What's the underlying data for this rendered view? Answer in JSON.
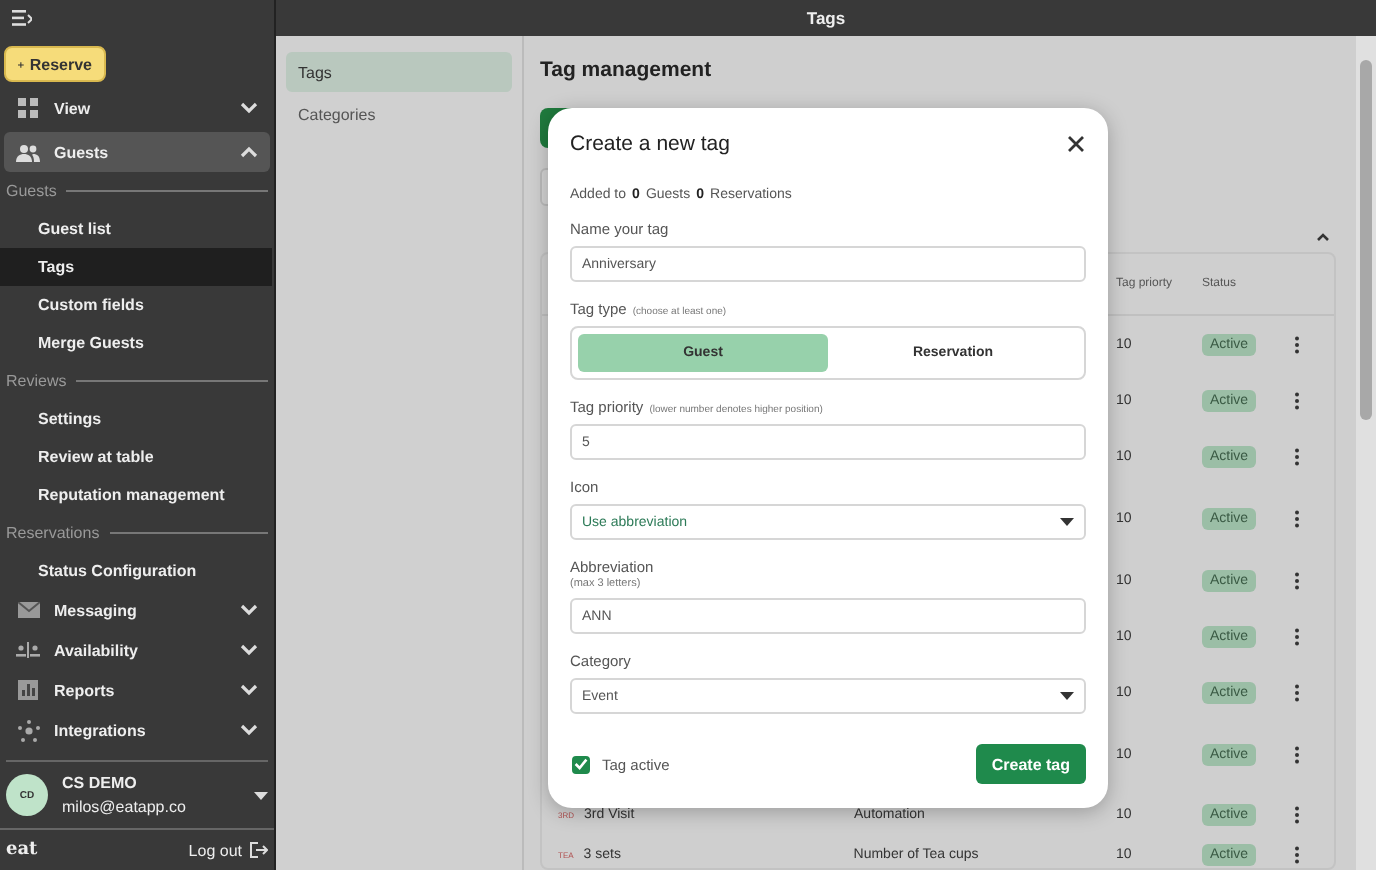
{
  "sidebar": {
    "reserve_button": "Reserve",
    "items": [
      {
        "kind": "group",
        "label": "View",
        "expanded": false,
        "selected": false
      },
      {
        "kind": "group",
        "label": "Guests",
        "expanded": true,
        "selected": true
      },
      {
        "kind": "section",
        "label": "Guests"
      },
      {
        "kind": "link",
        "label": "Guest list",
        "selected": false
      },
      {
        "kind": "link",
        "label": "Tags",
        "selected": true
      },
      {
        "kind": "link",
        "label": "Custom fields",
        "selected": false
      },
      {
        "kind": "link",
        "label": "Merge Guests",
        "selected": false
      },
      {
        "kind": "section",
        "label": "Reviews"
      },
      {
        "kind": "link",
        "label": "Settings",
        "selected": false
      },
      {
        "kind": "link",
        "label": "Review at table",
        "selected": false
      },
      {
        "kind": "link",
        "label": "Reputation management",
        "selected": false
      },
      {
        "kind": "section",
        "label": "Reservations"
      },
      {
        "kind": "link",
        "label": "Status Configuration",
        "selected": false
      },
      {
        "kind": "group",
        "label": "Messaging",
        "expanded": false,
        "selected": false
      },
      {
        "kind": "group",
        "label": "Availability",
        "expanded": false,
        "selected": false
      },
      {
        "kind": "group",
        "label": "Reports",
        "expanded": false,
        "selected": false
      },
      {
        "kind": "group",
        "label": "Integrations",
        "expanded": false,
        "selected": false
      }
    ],
    "profile": {
      "initials": "CD",
      "name": "CS DEMO",
      "email": "milos@eatapp.co"
    },
    "logo": "eat",
    "logout": "Log out"
  },
  "top_bar": {
    "title": "Tags"
  },
  "sub_nav": [
    {
      "label": "Tags",
      "selected": true
    },
    {
      "label": "Categories",
      "selected": false
    }
  ],
  "main": {
    "heading": "Tag management",
    "table": {
      "columns": [
        "Tag priorty",
        "Status"
      ],
      "rows": [
        {
          "priority": "10",
          "status": "Active"
        },
        {
          "priority": "10",
          "status": "Active"
        },
        {
          "priority": "10",
          "status": "Active"
        },
        {
          "priority": "10",
          "status": "Active"
        },
        {
          "priority": "10",
          "status": "Active"
        },
        {
          "priority": "10",
          "status": "Active"
        },
        {
          "priority": "10",
          "status": "Active"
        },
        {
          "priority": "10",
          "status": "Active"
        },
        {
          "abbr": "3RD",
          "name": "3rd Visit",
          "category": "Automation",
          "priority": "10",
          "status": "Active"
        },
        {
          "abbr": "TEA",
          "name": "3 sets",
          "category": "Number of Tea cups",
          "priority": "10",
          "status": "Active"
        }
      ]
    }
  },
  "dialog": {
    "title": "Create a new tag",
    "added": {
      "prefix": "Added to",
      "guests_count": "0",
      "guests": "Guests",
      "reservations_count": "0",
      "reservations": "Reservations"
    },
    "name": {
      "label": "Name your tag",
      "value": "Anniversary"
    },
    "tag_type": {
      "label": "Tag type",
      "hint": "(choose at least one)",
      "options": [
        {
          "label": "Guest",
          "selected": true
        },
        {
          "label": "Reservation",
          "selected": false
        }
      ]
    },
    "priority": {
      "label": "Tag priority",
      "hint": "(lower number denotes higher position)",
      "value": "5"
    },
    "icon": {
      "label": "Icon",
      "value": "Use abbreviation"
    },
    "abbreviation": {
      "label": "Abbreviation",
      "hint": "(max 3 letters)",
      "value": "ANN"
    },
    "category": {
      "label": "Category",
      "value": "Event"
    },
    "active": {
      "label": "Tag active",
      "checked": true
    },
    "submit": "Create tag"
  }
}
